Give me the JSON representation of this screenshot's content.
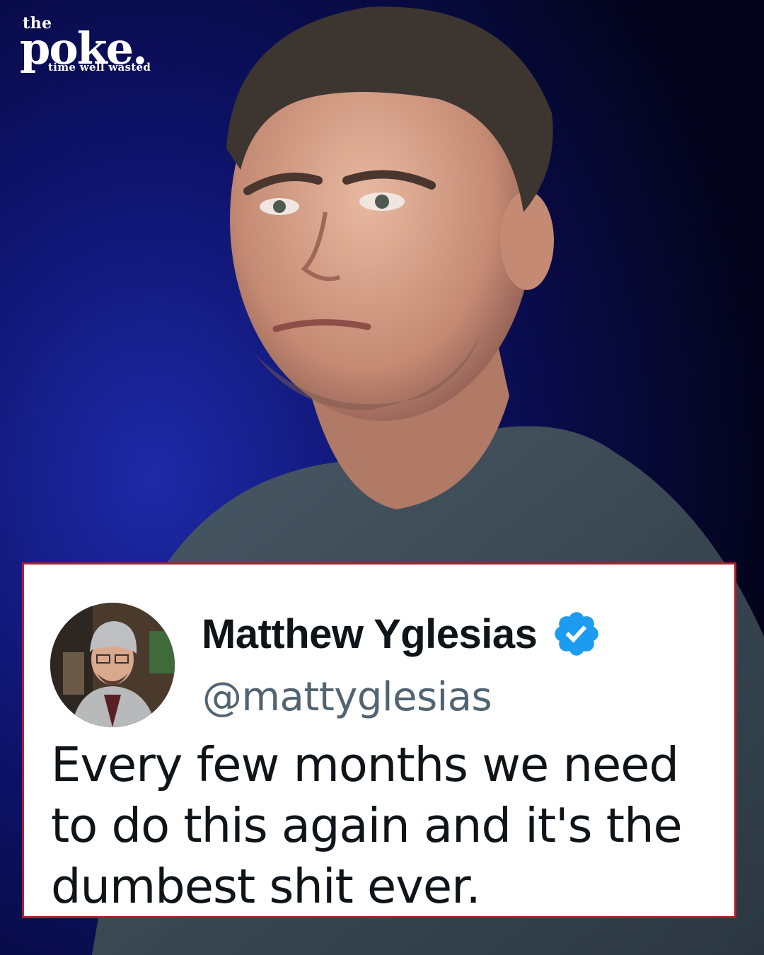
{
  "logo": {
    "the": "the",
    "name": "poke.",
    "tagline": "time well wasted"
  },
  "photo": {
    "icon": "portrait-photo",
    "background_color": "#05062a"
  },
  "tweet": {
    "display_name": "Matthew Yglesias",
    "handle": "@mattyglesias",
    "verified": true,
    "verified_color": "#1d9bf0",
    "text": "Every few months we need to do this again and it's the dumbest shit ever.",
    "border_color": "#b01e2e"
  }
}
